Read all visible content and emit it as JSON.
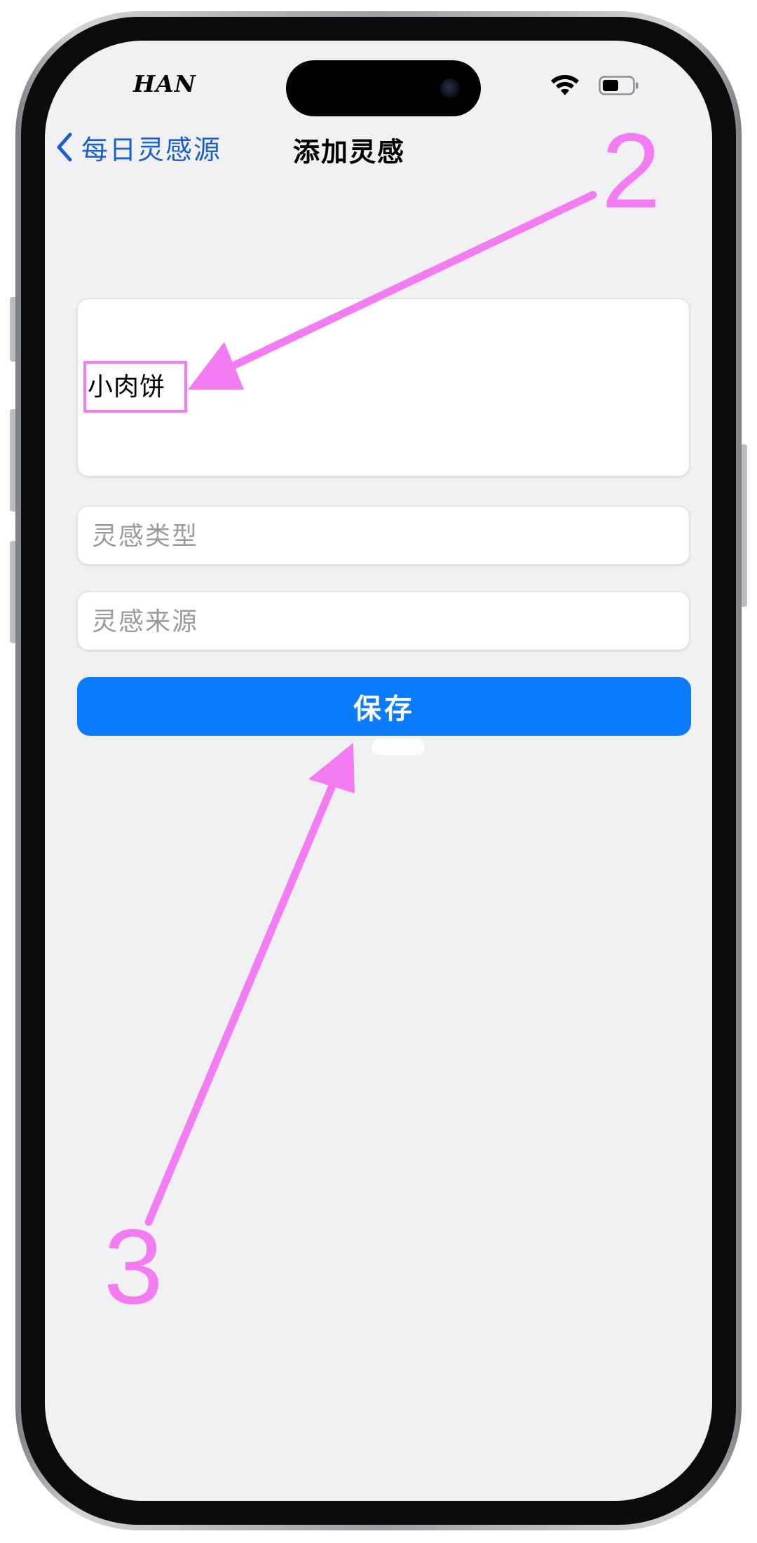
{
  "status_bar": {
    "carrier": "HAN",
    "icons": [
      "wifi-icon",
      "battery-icon"
    ]
  },
  "nav": {
    "back_label": "每日灵感源",
    "back_icon": "chevron-left-icon",
    "title": "添加灵感"
  },
  "form": {
    "content_value": "小肉饼",
    "type_placeholder": "灵感类型",
    "source_placeholder": "灵感来源",
    "save_label": "保存"
  },
  "annotations": {
    "step_2": "2",
    "step_3": "3",
    "color": "#f47cf2"
  },
  "colors": {
    "accent": "#0a7bfc",
    "nav_link": "#1a5fd0",
    "background": "#f1f0f2"
  }
}
